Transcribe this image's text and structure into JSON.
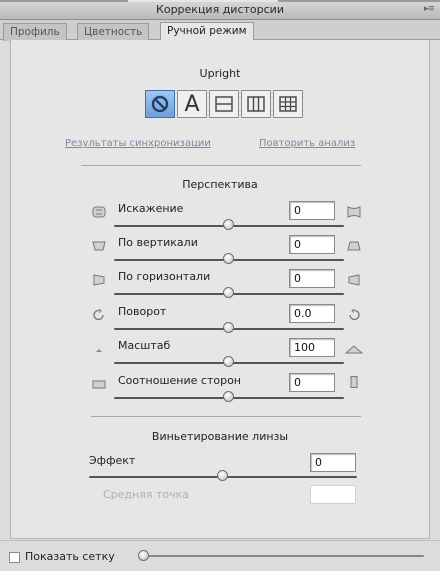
{
  "window": {
    "title": "Коррекция дисторсии"
  },
  "tabs": [
    {
      "label": "Профиль"
    },
    {
      "label": "Цветность"
    },
    {
      "label": "Ручной режим"
    }
  ],
  "upright": {
    "label": "Upright",
    "buttons": [
      {
        "icon": "upright-off-icon"
      },
      {
        "icon": "upright-auto-icon"
      },
      {
        "icon": "upright-level-icon"
      },
      {
        "icon": "upright-vertical-icon"
      },
      {
        "icon": "upright-full-icon"
      }
    ],
    "auto_glyph": "A",
    "sync_results_link": "Результаты синхронизации",
    "reanalyze_link": "Повторить анализ"
  },
  "perspective": {
    "title": "Перспектива",
    "rows": [
      {
        "label": "Искажение",
        "value": "0",
        "slider": 0.5,
        "icon_left": "distortion-icon",
        "icon_right": "distortion-max-icon"
      },
      {
        "label": "По вертикали",
        "value": "0",
        "slider": 0.5,
        "icon_left": "vertical-left-icon",
        "icon_right": "vertical-right-icon"
      },
      {
        "label": "По горизонтали",
        "value": "0",
        "slider": 0.5,
        "icon_left": "horizontal-left-icon",
        "icon_right": "horizontal-right-icon"
      },
      {
        "label": "Поворот",
        "value": "0.0",
        "slider": 0.5,
        "icon_left": "rotate-ccw-icon",
        "icon_right": "rotate-cw-icon"
      },
      {
        "label": "Масштаб",
        "value": "100",
        "slider": 0.5,
        "icon_left": "scale-small-icon",
        "icon_right": "scale-large-icon"
      },
      {
        "label": "Соотношение сторон",
        "value": "0",
        "slider": 0.5,
        "icon_left": "aspect-wide-icon",
        "icon_right": "aspect-tall-icon"
      }
    ]
  },
  "vignette": {
    "title": "Виньетирование линзы",
    "effect_label": "Эффект",
    "effect_value": "0",
    "effect_slider": 0.5,
    "midpoint_label": "Средняя точка",
    "midpoint_value": ""
  },
  "bottom": {
    "show_grid_label": "Показать сетку",
    "show_grid_checked": false,
    "grid_slider": 0.0
  }
}
